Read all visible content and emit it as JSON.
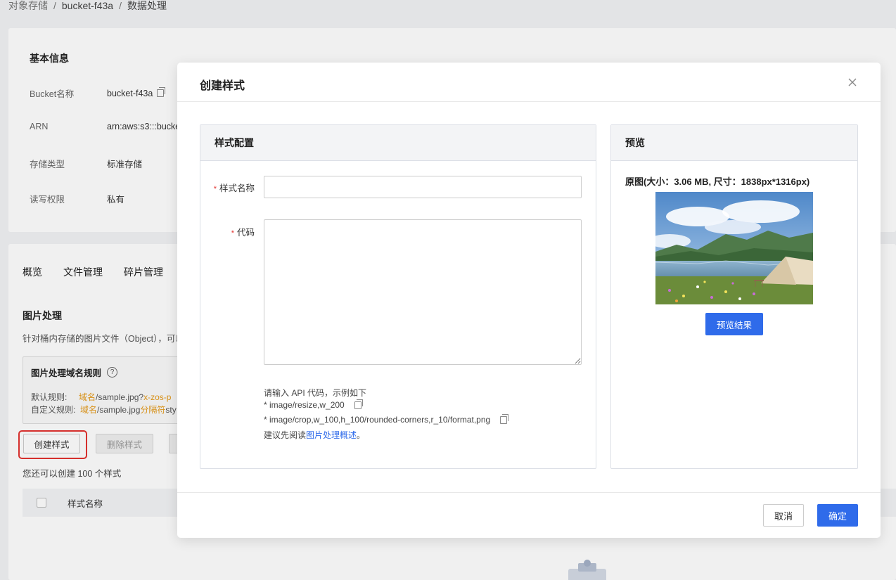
{
  "breadcrumb": [
    "对象存储",
    "bucket-f43a",
    "数据处理"
  ],
  "basic_info": {
    "title": "基本信息",
    "rows": [
      {
        "key": "Bucket名称",
        "value": "bucket-f43a"
      },
      {
        "key": "ARN",
        "value": "arn:aws:s3:::bucke"
      },
      {
        "key": "存储类型",
        "value": "标准存储"
      },
      {
        "key": "读写权限",
        "value": "私有"
      }
    ]
  },
  "tabs": [
    "概览",
    "文件管理",
    "碎片管理"
  ],
  "image_processing": {
    "title": "图片处理",
    "description": "针对桶内存储的图片文件（Object），可以",
    "rule_box": {
      "title": "图片处理域名规则",
      "help": "?",
      "default_label": "默认规则:",
      "default_domain": "域名",
      "default_path": "/sample.jpg?",
      "default_suffix": "x-zos-p",
      "custom_label": "自定义规则:",
      "custom_domain": "域名",
      "custom_path": "/sample.jpg",
      "custom_sep": "分隔符",
      "custom_suffix": "sty"
    },
    "create_btn": "创建样式",
    "delete_btn": "删除样式",
    "quota_text": "您还可以创建 100 个样式",
    "table_col_name": "样式名称"
  },
  "modal": {
    "title": "创建样式",
    "config_panel_title": "样式配置",
    "preview_panel_title": "预览",
    "name_label": "样式名称",
    "code_label": "代码",
    "name_value": "",
    "code_value": "",
    "hint_intro": "请输入 API 代码，示例如下",
    "hint_example1": "* image/resize,w_200",
    "hint_example2": "* image/crop,w_100,h_100/rounded-corners,r_10/format,png",
    "hint_read_prefix": "建议先阅读",
    "hint_read_link": "图片处理概述",
    "hint_read_suffix": "。",
    "original_info": "原图(大小：3.06 MB, 尺寸：1838px*1316px)",
    "preview_btn": "预览结果",
    "cancel_btn": "取消",
    "ok_btn": "确定"
  },
  "colors": {
    "primary": "#2f6bea",
    "required": "#e3322f",
    "highlight_border": "#e3322f",
    "rule_orange": "#e59b1b"
  }
}
